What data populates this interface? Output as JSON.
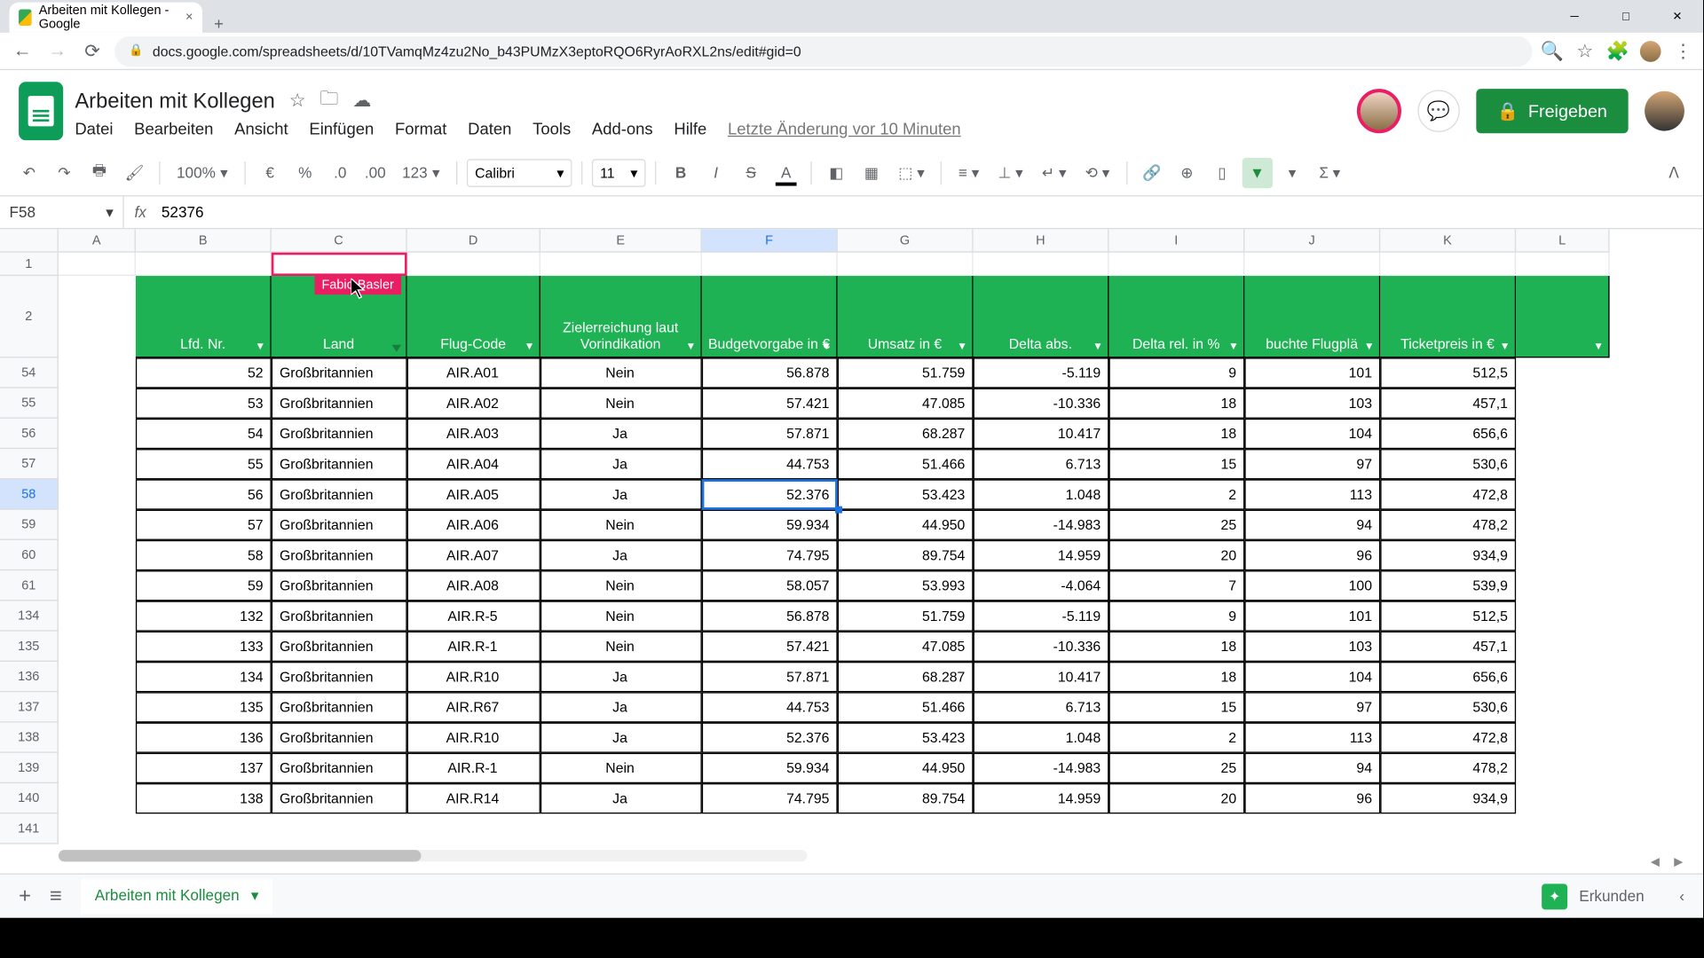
{
  "browser": {
    "tab_title": "Arbeiten mit Kollegen - Google",
    "url": "docs.google.com/spreadsheets/d/10TVamqMz4zu2No_b43PUMzX3eptoRQO6RyrAoRXL2ns/edit#gid=0"
  },
  "doc": {
    "title": "Arbeiten mit Kollegen",
    "menu": [
      "Datei",
      "Bearbeiten",
      "Ansicht",
      "Einfügen",
      "Format",
      "Daten",
      "Tools",
      "Add-ons",
      "Hilfe"
    ],
    "last_edit": "Letzte Änderung vor 10 Minuten",
    "share": "Freigeben"
  },
  "toolbar": {
    "zoom": "100%",
    "format": "123",
    "font": "Calibri",
    "size": "11"
  },
  "formula_bar": {
    "name_box": "F58",
    "value": "52376"
  },
  "collaborator": {
    "name": "Fabio Basler"
  },
  "columns": [
    "A",
    "B",
    "C",
    "D",
    "E",
    "F",
    "G",
    "H",
    "I",
    "J",
    "K",
    "L"
  ],
  "selected_col": "F",
  "row_numbers": [
    "1",
    "2",
    "54",
    "55",
    "56",
    "57",
    "58",
    "59",
    "60",
    "61",
    "134",
    "135",
    "136",
    "137",
    "138",
    "139",
    "140",
    "141"
  ],
  "selected_row": "58",
  "headers": [
    "",
    "Lfd. Nr.",
    "Land",
    "Flug-Code",
    "Zielerreichung laut Vorindikation",
    "Budgetvorgabe in €",
    "Umsatz in €",
    "Delta abs.",
    "Delta rel. in %",
    "buchte Flugplä",
    "Ticketpreis in €"
  ],
  "data_rows": [
    {
      "b": "52",
      "c": "Großbritannien",
      "d": "AIR.A01",
      "e": "Nein",
      "f": "56.878",
      "g": "51.759",
      "h": "-5.119",
      "i": "9",
      "j": "101",
      "k": "512,5"
    },
    {
      "b": "53",
      "c": "Großbritannien",
      "d": "AIR.A02",
      "e": "Nein",
      "f": "57.421",
      "g": "47.085",
      "h": "-10.336",
      "i": "18",
      "j": "103",
      "k": "457,1"
    },
    {
      "b": "54",
      "c": "Großbritannien",
      "d": "AIR.A03",
      "e": "Ja",
      "f": "57.871",
      "g": "68.287",
      "h": "10.417",
      "i": "18",
      "j": "104",
      "k": "656,6"
    },
    {
      "b": "55",
      "c": "Großbritannien",
      "d": "AIR.A04",
      "e": "Ja",
      "f": "44.753",
      "g": "51.466",
      "h": "6.713",
      "i": "15",
      "j": "97",
      "k": "530,6"
    },
    {
      "b": "56",
      "c": "Großbritannien",
      "d": "AIR.A05",
      "e": "Ja",
      "f": "52.376",
      "g": "53.423",
      "h": "1.048",
      "i": "2",
      "j": "113",
      "k": "472,8"
    },
    {
      "b": "57",
      "c": "Großbritannien",
      "d": "AIR.A06",
      "e": "Nein",
      "f": "59.934",
      "g": "44.950",
      "h": "-14.983",
      "i": "25",
      "j": "94",
      "k": "478,2"
    },
    {
      "b": "58",
      "c": "Großbritannien",
      "d": "AIR.A07",
      "e": "Ja",
      "f": "74.795",
      "g": "89.754",
      "h": "14.959",
      "i": "20",
      "j": "96",
      "k": "934,9"
    },
    {
      "b": "59",
      "c": "Großbritannien",
      "d": "AIR.A08",
      "e": "Nein",
      "f": "58.057",
      "g": "53.993",
      "h": "-4.064",
      "i": "7",
      "j": "100",
      "k": "539,9"
    },
    {
      "b": "132",
      "c": "Großbritannien",
      "d": "AIR.R-5",
      "e": "Nein",
      "f": "56.878",
      "g": "51.759",
      "h": "-5.119",
      "i": "9",
      "j": "101",
      "k": "512,5"
    },
    {
      "b": "133",
      "c": "Großbritannien",
      "d": "AIR.R-1",
      "e": "Nein",
      "f": "57.421",
      "g": "47.085",
      "h": "-10.336",
      "i": "18",
      "j": "103",
      "k": "457,1"
    },
    {
      "b": "134",
      "c": "Großbritannien",
      "d": "AIR.R10",
      "e": "Ja",
      "f": "57.871",
      "g": "68.287",
      "h": "10.417",
      "i": "18",
      "j": "104",
      "k": "656,6"
    },
    {
      "b": "135",
      "c": "Großbritannien",
      "d": "AIR.R67",
      "e": "Ja",
      "f": "44.753",
      "g": "51.466",
      "h": "6.713",
      "i": "15",
      "j": "97",
      "k": "530,6"
    },
    {
      "b": "136",
      "c": "Großbritannien",
      "d": "AIR.R10",
      "e": "Ja",
      "f": "52.376",
      "g": "53.423",
      "h": "1.048",
      "i": "2",
      "j": "113",
      "k": "472,8"
    },
    {
      "b": "137",
      "c": "Großbritannien",
      "d": "AIR.R-1",
      "e": "Nein",
      "f": "59.934",
      "g": "44.950",
      "h": "-14.983",
      "i": "25",
      "j": "94",
      "k": "478,2"
    },
    {
      "b": "138",
      "c": "Großbritannien",
      "d": "AIR.R14",
      "e": "Ja",
      "f": "74.795",
      "g": "89.754",
      "h": "14.959",
      "i": "20",
      "j": "96",
      "k": "934,9"
    }
  ],
  "sheet_tab": "Arbeiten mit Kollegen",
  "explore": "Erkunden"
}
